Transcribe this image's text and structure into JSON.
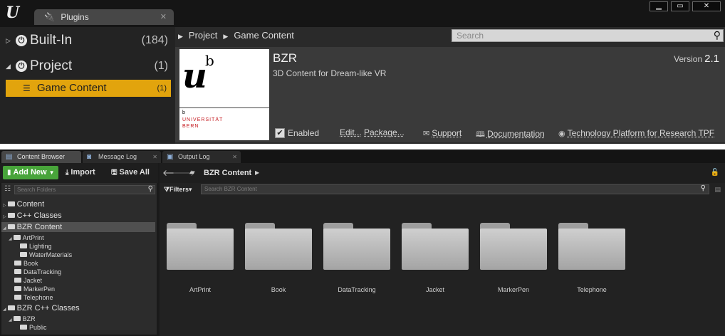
{
  "plugins_window": {
    "logo": "U",
    "tab": {
      "icon": "plug-icon",
      "label": "Plugins",
      "close": "✕"
    },
    "controls": {
      "minimize": "▁",
      "maximize": "▭",
      "close": "✕"
    },
    "categories": [
      {
        "label": "Built-In",
        "count": "(184)",
        "expanded": false
      },
      {
        "label": "Project",
        "count": "(1)",
        "expanded": true
      }
    ],
    "selected_category": {
      "label": "Game Content",
      "count": "(1)"
    },
    "breadcrumb": [
      "Project",
      "Game Content"
    ],
    "search": {
      "placeholder": "Search"
    },
    "plugin": {
      "name": "BZR",
      "description": "3D Content for Dream-like VR",
      "version_label": "Version",
      "version": "2.1",
      "enabled_label": "Enabled",
      "enabled": true,
      "edit_label": "Edit...",
      "package_label": "Package...",
      "support_label": "Support",
      "documentation_label": "Documentation",
      "tpf_label": "Technology Platform for Research TPF",
      "logo": {
        "u": "u",
        "b": "b",
        "small_b": "b",
        "line1": "UNIVERSITÄT",
        "line2": "BERN"
      }
    }
  },
  "content_browser": {
    "tabs": [
      {
        "label": "Content Browser",
        "active": true
      },
      {
        "label": "Message Log",
        "active": false
      },
      {
        "label": "Output Log",
        "active": false
      }
    ],
    "toolbar": {
      "add_new": "Add New",
      "import": "Import",
      "save_all": "Save All"
    },
    "folder_search_placeholder": "Search Folders",
    "tree": [
      {
        "label": "Content"
      },
      {
        "label": "C++ Classes"
      },
      {
        "label": "BZR Content"
      },
      {
        "label": "ArtPrint"
      },
      {
        "label": "Lighting"
      },
      {
        "label": "WaterMaterials"
      },
      {
        "label": "Book"
      },
      {
        "label": "DataTracking"
      },
      {
        "label": "Jacket"
      },
      {
        "label": "MarkerPen"
      },
      {
        "label": "Telephone"
      },
      {
        "label": "BZR C++ Classes"
      },
      {
        "label": "BZR"
      },
      {
        "label": "Public"
      }
    ],
    "path": "BZR Content",
    "filters_label": "Filters",
    "asset_search_placeholder": "Search BZR Content",
    "assets": [
      "ArtPrint",
      "Book",
      "DataTracking",
      "Jacket",
      "MarkerPen",
      "Telephone"
    ],
    "colors": {
      "add_new": "#48a43a",
      "selected_category": "#e2a40d"
    }
  }
}
